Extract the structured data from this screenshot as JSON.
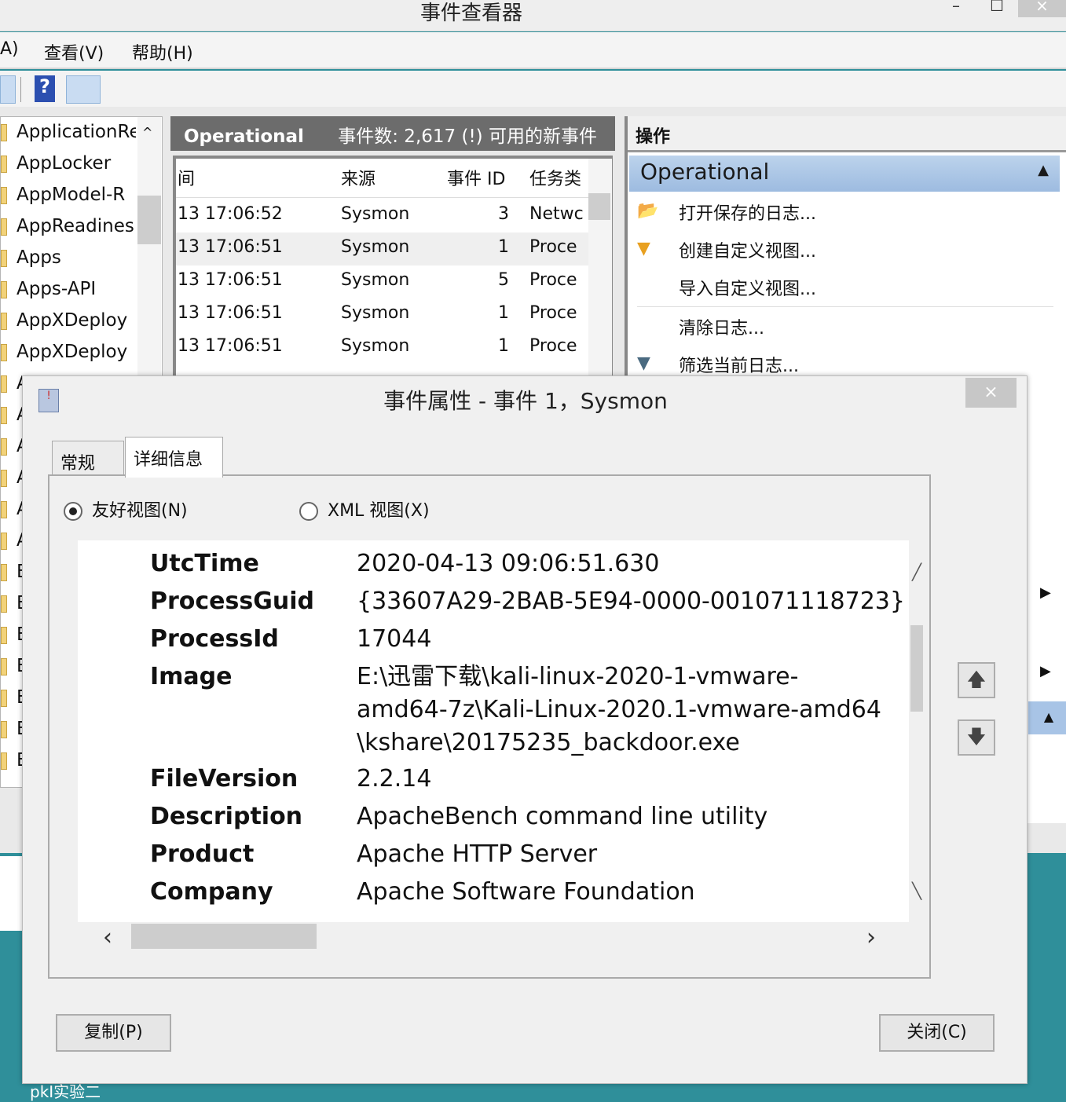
{
  "window": {
    "title": "事件查看器",
    "minimize": "–",
    "maximize": "☐",
    "close": "×"
  },
  "menu": [
    "A)",
    "查看(V)",
    "帮助(H)"
  ],
  "tree": [
    "ApplicationRe",
    "AppLocker",
    "AppModel-R",
    "AppReadines",
    "Apps",
    "Apps-API",
    "AppXDeploy",
    "AppXDeploy",
    "A",
    "A",
    "A",
    "A",
    "A",
    "A",
    "E",
    "E",
    "E",
    "E",
    "E",
    "E",
    "E"
  ],
  "center": {
    "log_name": "Operational",
    "event_count": "事件数: 2,617 (!) 可用的新事件",
    "columns": [
      "间",
      "来源",
      "事件 ID",
      "任务类"
    ],
    "rows": [
      [
        "13 17:06:52",
        "Sysmon",
        "3",
        "Netwc"
      ],
      [
        "13 17:06:51",
        "Sysmon",
        "1",
        "Proce"
      ],
      [
        "13 17:06:51",
        "Sysmon",
        "5",
        "Proce"
      ],
      [
        "13 17:06:51",
        "Sysmon",
        "1",
        "Proce"
      ],
      [
        "13 17:06:51",
        "Sysmon",
        "1",
        "Proce"
      ]
    ]
  },
  "actions": {
    "header": "操作",
    "section": "Operational",
    "items": [
      "打开保存的日志...",
      "创建自定义视图...",
      "导入自定义视图...",
      "清除日志...",
      "筛选当前日志..."
    ]
  },
  "dialog": {
    "title": "事件属性 - 事件 1，Sysmon",
    "close": "×",
    "tabs": [
      "常规",
      "详细信息"
    ],
    "active_tab": 1,
    "views": [
      "友好视图(N)",
      "XML 视图(X)"
    ],
    "selected_view": 0,
    "fields": [
      {
        "key": "UtcTime",
        "value": [
          "2020-04-13 09:06:51.630"
        ]
      },
      {
        "key": "ProcessGuid",
        "value": [
          "{33607A29-2BAB-5E94-0000-001071118723}"
        ]
      },
      {
        "key": "ProcessId",
        "value": [
          "17044"
        ]
      },
      {
        "key": "Image",
        "value": [
          "E:\\迅雷下载\\kali-linux-2020-1-vmware-",
          "amd64-7z\\Kali-Linux-2020.1-vmware-amd64",
          "\\kshare\\20175235_backdoor.exe"
        ]
      },
      {
        "key": "FileVersion",
        "value": [
          "2.2.14"
        ]
      },
      {
        "key": "Description",
        "value": [
          "ApacheBench command line utility"
        ]
      },
      {
        "key": "Product",
        "value": [
          "Apache HTTP Server"
        ]
      },
      {
        "key": "Company",
        "value": [
          "Apache Software Foundation"
        ]
      }
    ],
    "copy": "复制(P)",
    "close_button": "关闭(C)"
  },
  "desktop_label": "pkI实验二"
}
